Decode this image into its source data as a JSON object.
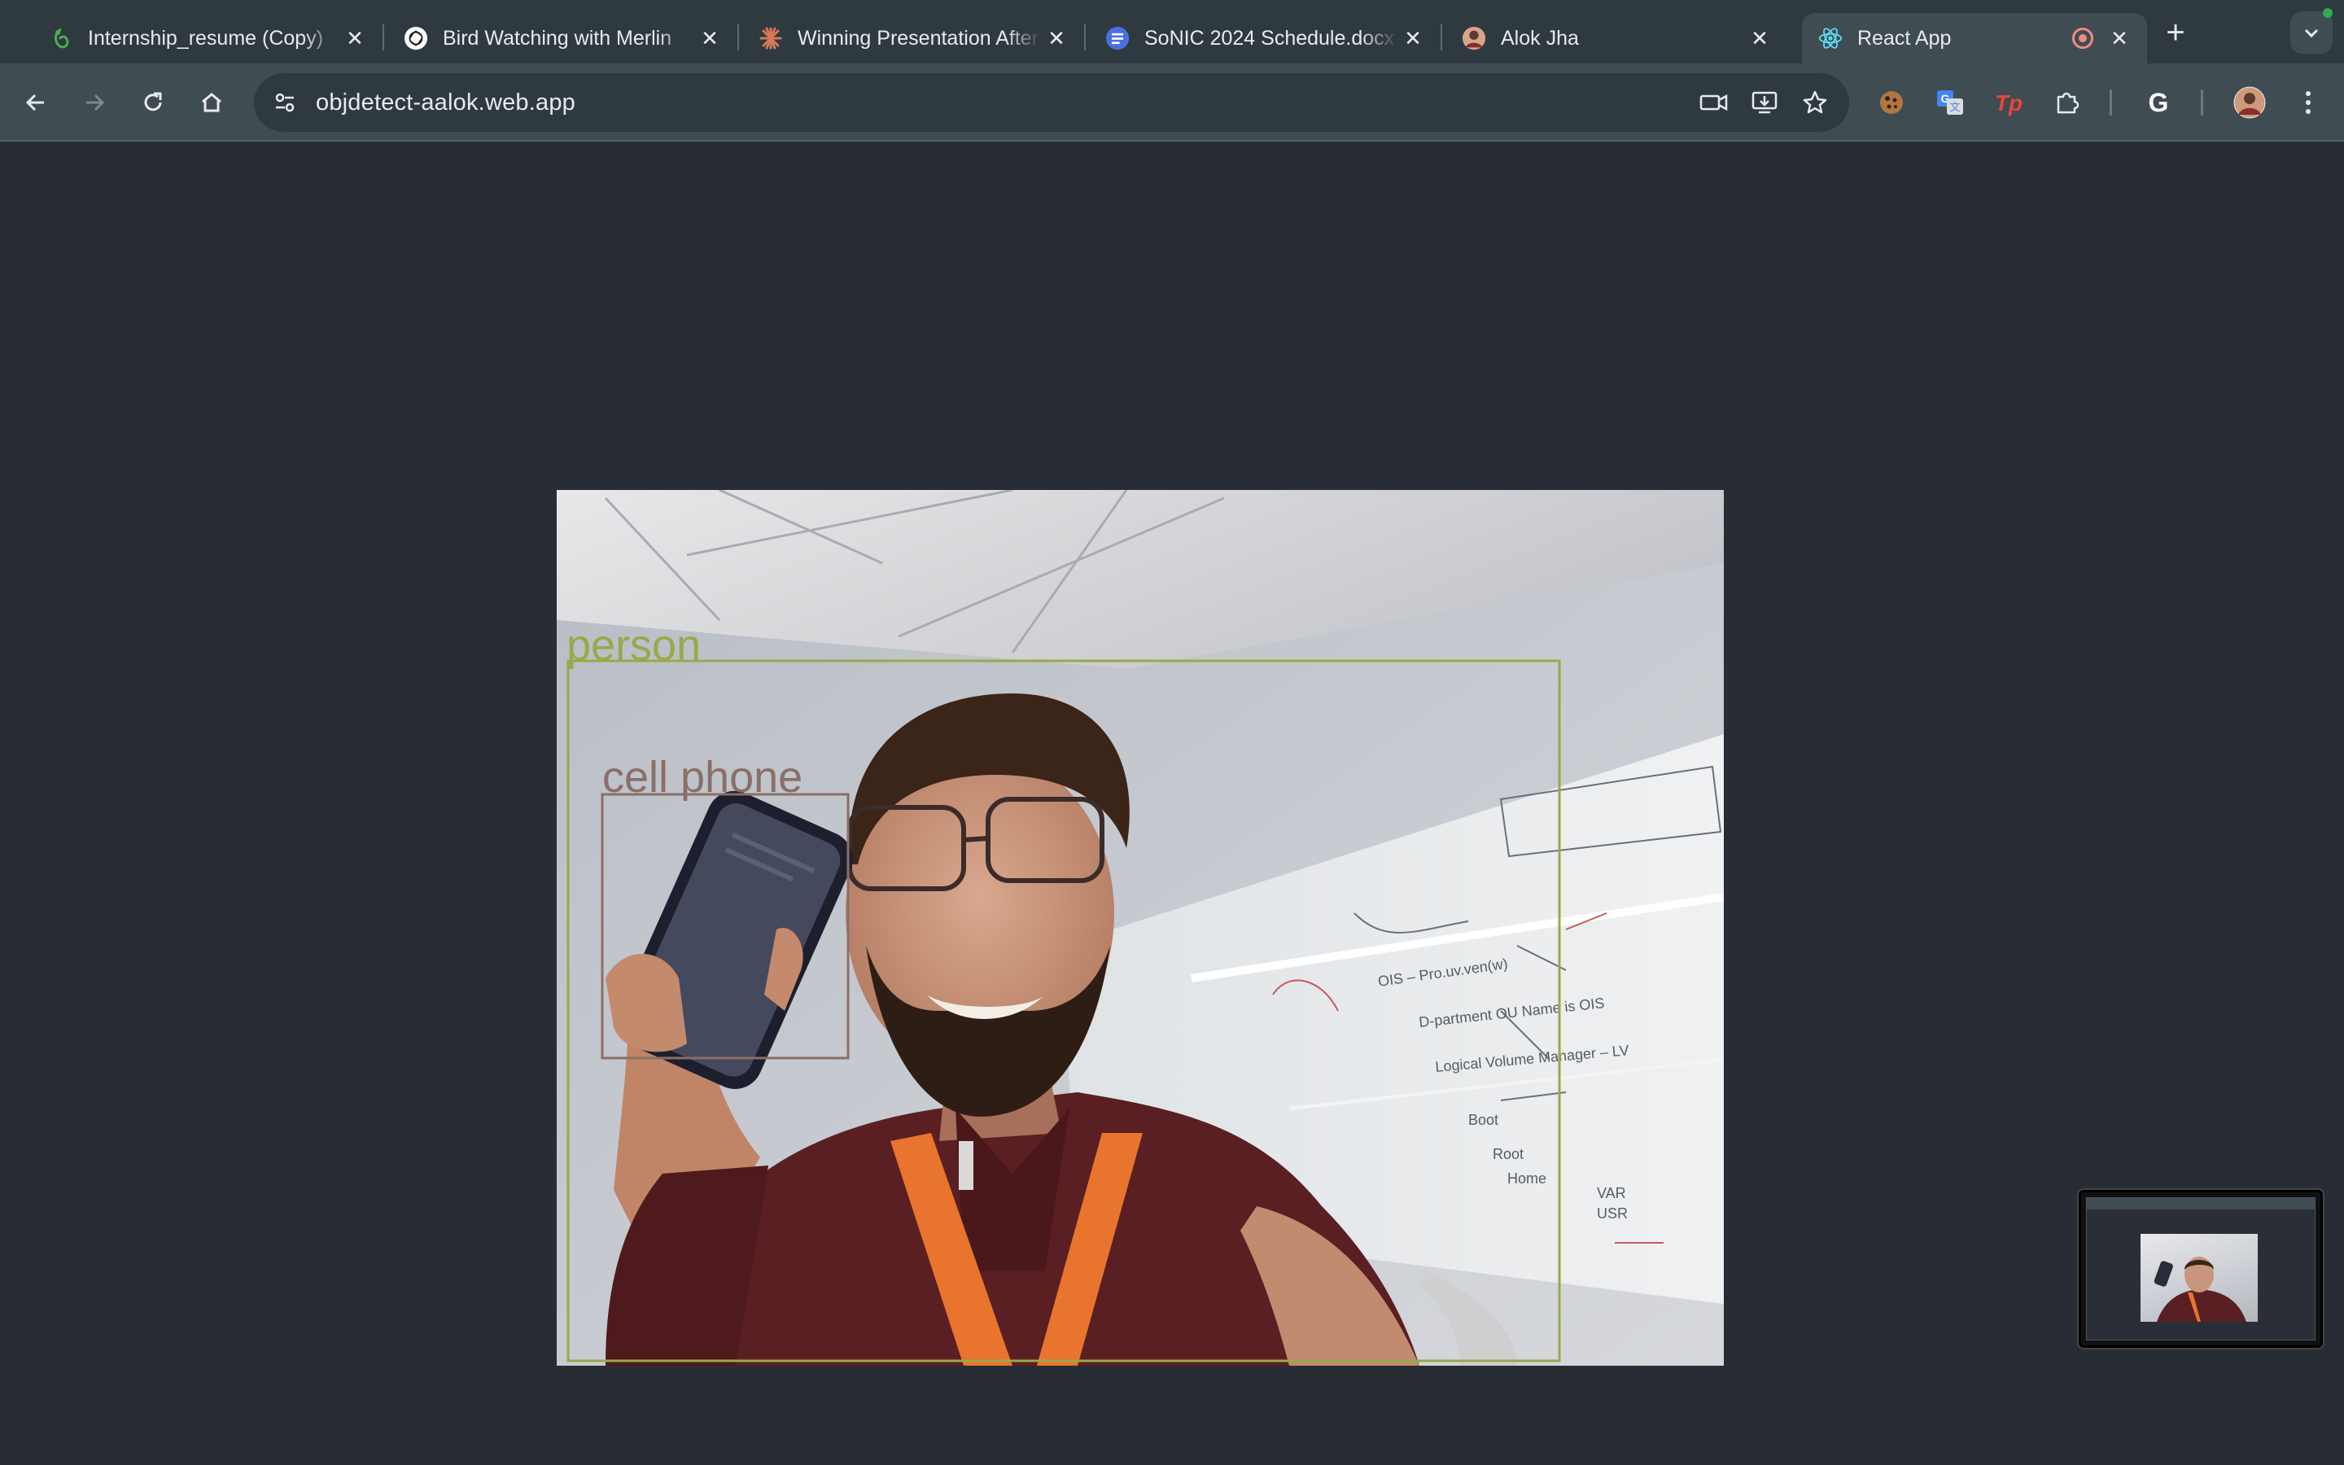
{
  "browser": {
    "tabs": [
      {
        "title": "Internship_resume (Copy)",
        "icon": "overleaf-icon",
        "active": false
      },
      {
        "title": "Bird Watching with Merlin",
        "icon": "openai-icon",
        "active": false
      },
      {
        "title": "Winning Presentation After",
        "icon": "claude-icon",
        "active": false
      },
      {
        "title": "SoNIC 2024 Schedule.docx",
        "icon": "google-docs-icon",
        "active": false
      },
      {
        "title": "Alok Jha",
        "icon": "profile-avatar-icon",
        "active": false
      },
      {
        "title": "React App",
        "icon": "react-icon",
        "active": true,
        "recording": true
      }
    ],
    "address_bar": {
      "url": "objdetect-aalok.web.app"
    },
    "colors": {
      "tabstrip_bg": "#2f3a40",
      "toolbar_bg": "#3f4c52",
      "page_bg": "#282c34"
    }
  },
  "page": {
    "detections": [
      {
        "label": "person",
        "color": "#9aa84a"
      },
      {
        "label": "cell phone",
        "color": "#8a6f66"
      }
    ],
    "whiteboard_scribbles": [
      "OIS – Pro.uv.ven(w)",
      "D-partment OU Name is OIS",
      "Logical Volume Manager – LV",
      "Boot",
      "Root",
      "Home",
      "VAR",
      "USR"
    ]
  }
}
